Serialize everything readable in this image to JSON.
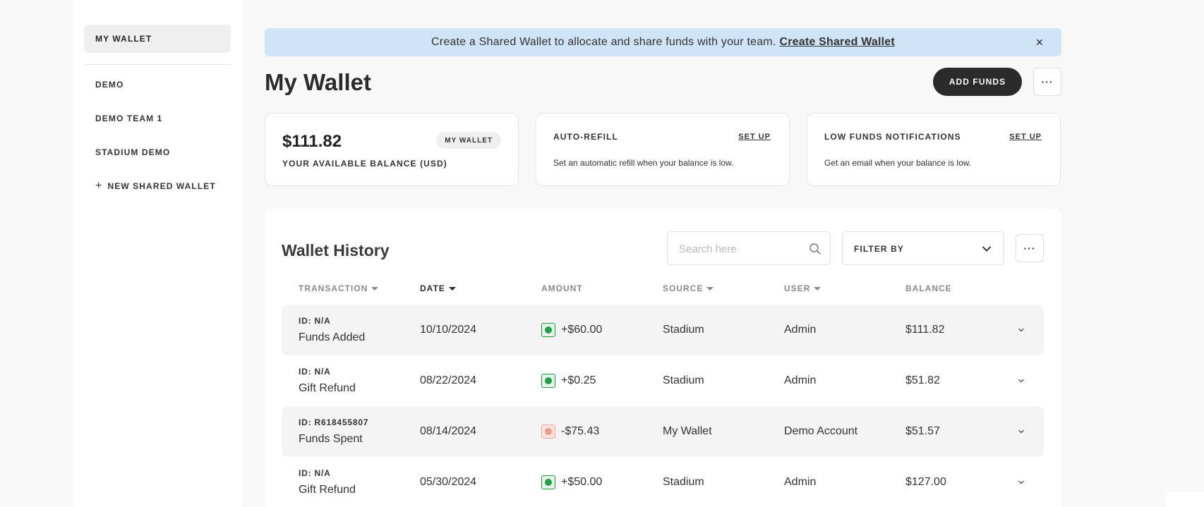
{
  "sidebar": {
    "items": [
      {
        "label": "MY WALLET"
      },
      {
        "label": "DEMO"
      },
      {
        "label": "DEMO TEAM 1"
      },
      {
        "label": "STADIUM DEMO"
      }
    ],
    "new_wallet_label": "NEW SHARED WALLET"
  },
  "banner": {
    "text": "Create a Shared Wallet to allocate and share funds with your team.",
    "link": "Create Shared Wallet",
    "close": "×"
  },
  "header": {
    "title": "My Wallet",
    "add_funds": "ADD FUNDS",
    "more": "···"
  },
  "balance_card": {
    "amount": "$111.82",
    "label": "YOUR AVAILABLE BALANCE (USD)",
    "badge": "MY WALLET"
  },
  "auto_refill_card": {
    "title": "AUTO-REFILL",
    "link": "SET UP",
    "description": "Set an automatic refill when your balance is low."
  },
  "low_funds_card": {
    "title": "LOW FUNDS NOTIFICATIONS",
    "link": "SET UP",
    "description": "Get an email when your balance is low."
  },
  "history": {
    "title": "Wallet History",
    "search_placeholder": "Search here",
    "filter_label": "FILTER BY",
    "more": "···",
    "columns": {
      "transaction": "TRANSACTION",
      "date": "DATE",
      "amount": "AMOUNT",
      "source": "SOURCE",
      "user": "USER",
      "balance": "BALANCE"
    },
    "rows": [
      {
        "id": "ID: N/A",
        "name": "Funds Added",
        "date": "10/10/2024",
        "amount": "+$60.00",
        "direction": "positive",
        "source": "Stadium",
        "user": "Admin",
        "balance": "$111.82"
      },
      {
        "id": "ID: N/A",
        "name": "Gift Refund",
        "date": "08/22/2024",
        "amount": "+$0.25",
        "direction": "positive",
        "source": "Stadium",
        "user": "Admin",
        "balance": "$51.82"
      },
      {
        "id": "ID: R618455807",
        "name": "Funds Spent",
        "date": "08/14/2024",
        "amount": "-$75.43",
        "direction": "negative",
        "source": "My Wallet",
        "user": "Demo Account",
        "balance": "$51.57"
      },
      {
        "id": "ID: N/A",
        "name": "Gift Refund",
        "date": "05/30/2024",
        "amount": "+$50.00",
        "direction": "positive",
        "source": "Stadium",
        "user": "Admin",
        "balance": "$127.00"
      }
    ]
  },
  "colors": {
    "banner_bg": "#cfe4f7",
    "primary_button": "#2b2b2b",
    "positive": "#1fa045",
    "negative": "#ee9b87"
  }
}
